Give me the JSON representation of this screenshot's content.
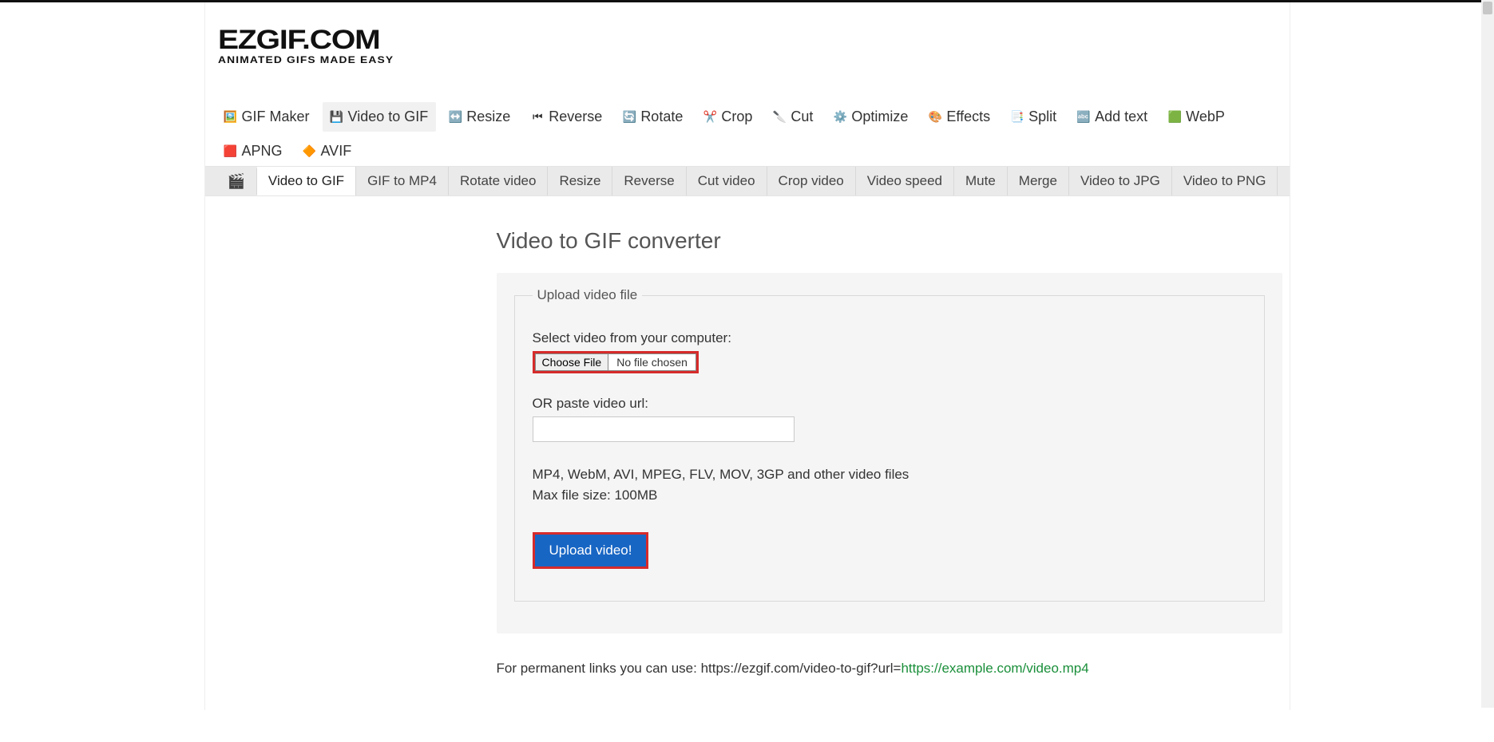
{
  "logo": {
    "main": "EZGIF.COM",
    "sub": "ANIMATED GIFS MADE EASY"
  },
  "nav_primary": [
    {
      "id": "gif-maker",
      "label": "GIF Maker",
      "icon": "🖼️"
    },
    {
      "id": "video-to-gif",
      "label": "Video to GIF",
      "icon": "💾",
      "active": true
    },
    {
      "id": "resize",
      "label": "Resize",
      "icon": "↔️"
    },
    {
      "id": "reverse",
      "label": "Reverse",
      "icon": "⏮"
    },
    {
      "id": "rotate",
      "label": "Rotate",
      "icon": "🔄"
    },
    {
      "id": "crop",
      "label": "Crop",
      "icon": "✂️"
    },
    {
      "id": "cut",
      "label": "Cut",
      "icon": "🔪"
    },
    {
      "id": "optimize",
      "label": "Optimize",
      "icon": "⚙️"
    },
    {
      "id": "effects",
      "label": "Effects",
      "icon": "🎨"
    },
    {
      "id": "split",
      "label": "Split",
      "icon": "📑"
    },
    {
      "id": "add-text",
      "label": "Add text",
      "icon": "🔤"
    },
    {
      "id": "webp",
      "label": "WebP",
      "icon": "🟩"
    },
    {
      "id": "apng",
      "label": "APNG",
      "icon": "🟥"
    },
    {
      "id": "avif",
      "label": "AVIF",
      "icon": "🔶"
    }
  ],
  "nav_secondary": [
    {
      "id": "home",
      "label": "🎬",
      "home": true
    },
    {
      "id": "video-to-gif",
      "label": "Video to GIF",
      "active": true
    },
    {
      "id": "gif-to-mp4",
      "label": "GIF to MP4"
    },
    {
      "id": "rotate-video",
      "label": "Rotate video"
    },
    {
      "id": "resize",
      "label": "Resize"
    },
    {
      "id": "reverse",
      "label": "Reverse"
    },
    {
      "id": "cut-video",
      "label": "Cut video"
    },
    {
      "id": "crop-video",
      "label": "Crop video"
    },
    {
      "id": "video-speed",
      "label": "Video speed"
    },
    {
      "id": "mute",
      "label": "Mute"
    },
    {
      "id": "merge",
      "label": "Merge"
    },
    {
      "id": "video-to-jpg",
      "label": "Video to JPG"
    },
    {
      "id": "video-to-png",
      "label": "Video to PNG"
    }
  ],
  "page": {
    "title": "Video to GIF converter"
  },
  "upload": {
    "legend": "Upload video file",
    "select_label": "Select video from your computer:",
    "choose_btn": "Choose File",
    "file_status": "No file chosen",
    "or_label": "OR paste video url:",
    "url_value": "",
    "formats_hint": "MP4, WebM, AVI, MPEG, FLV, MOV, 3GP and other video files",
    "size_hint": "Max file size: 100MB",
    "submit": "Upload video!"
  },
  "permalink": {
    "prefix": "For permanent links you can use: https://ezgif.com/video-to-gif?url=",
    "example": "https://example.com/video.mp4"
  },
  "colors": {
    "highlight_border": "#d62b2b",
    "primary_btn": "#1866c4"
  }
}
